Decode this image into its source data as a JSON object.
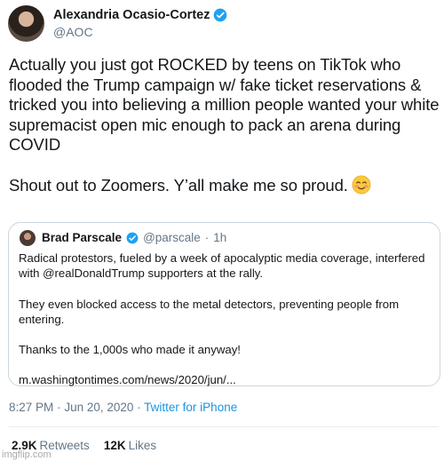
{
  "author": {
    "name": "Alexandria Ocasio-Cortez",
    "handle": "@AOC"
  },
  "tweet": {
    "text": "Actually you just got ROCKED by teens on TikTok who flooded the Trump campaign w/ fake ticket reservations & tricked you into believing a million people wanted your white supremacist open mic enough to pack an arena during COVID\n\nShout out to Zoomers. Y’all make me so proud.",
    "emoji": "smiling-face-with-blush"
  },
  "quoted_tweet": {
    "name": "Brad Parscale",
    "handle": "@parscale",
    "separator": "·",
    "time": "1h",
    "paragraphs": [
      "Radical protestors, fueled by a week of apocalyptic media coverage, interfered with @realDonaldTrump supporters at the rally.",
      "They even blocked access to the metal detectors, preventing people from entering.",
      "Thanks to the 1,000s who made it anyway!",
      "m.washingtontimes.com/news/2020/jun/..."
    ]
  },
  "meta": {
    "time": "8:27 PM",
    "separator1": "·",
    "date": "Jun 20, 2020",
    "separator2": "·",
    "source": "Twitter for iPhone"
  },
  "stats": {
    "retweets_count": "2.9K",
    "retweets_label": "Retweets",
    "likes_count": "12K",
    "likes_label": "Likes"
  },
  "watermark": "imgflip.com",
  "colors": {
    "text": "#14171a",
    "secondary": "#657786",
    "link": "#1b95e0",
    "verified": "#1da1f2",
    "border": "#ccd6dd"
  }
}
